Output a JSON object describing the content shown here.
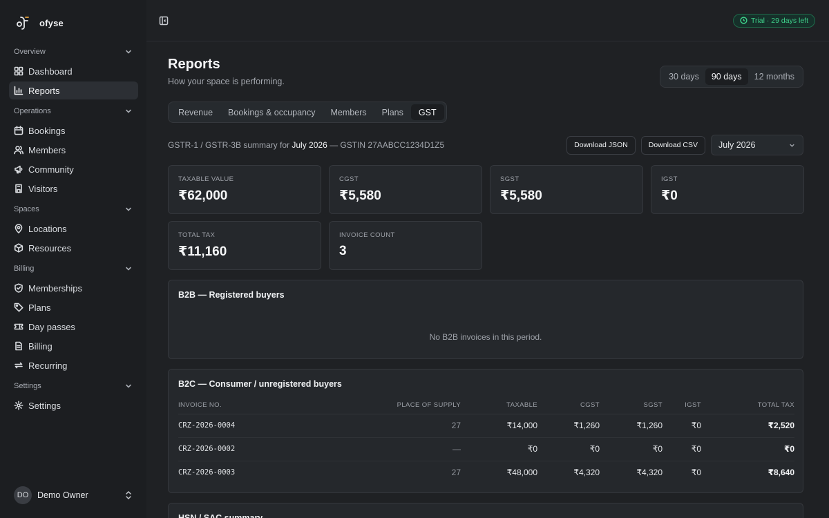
{
  "brand": {
    "name": "ofyse"
  },
  "sidebar": {
    "sections": [
      {
        "label": "Overview",
        "items": [
          {
            "label": "Dashboard",
            "icon": "grid-icon"
          },
          {
            "label": "Reports",
            "icon": "bar-chart-icon",
            "active": true
          }
        ]
      },
      {
        "label": "Operations",
        "items": [
          {
            "label": "Bookings",
            "icon": "calendar-icon"
          },
          {
            "label": "Members",
            "icon": "users-icon"
          },
          {
            "label": "Community",
            "icon": "megaphone-icon"
          },
          {
            "label": "Visitors",
            "icon": "badge-icon"
          }
        ]
      },
      {
        "label": "Spaces",
        "items": [
          {
            "label": "Locations",
            "icon": "map-pin-icon"
          },
          {
            "label": "Resources",
            "icon": "box-icon"
          }
        ]
      },
      {
        "label": "Billing",
        "items": [
          {
            "label": "Memberships",
            "icon": "shield-icon"
          },
          {
            "label": "Plans",
            "icon": "tag-icon"
          },
          {
            "label": "Day passes",
            "icon": "ticket-icon"
          },
          {
            "label": "Billing",
            "icon": "file-icon"
          },
          {
            "label": "Recurring",
            "icon": "repeat-icon"
          }
        ]
      },
      {
        "label": "Settings",
        "items": [
          {
            "label": "Settings",
            "icon": "gear-icon"
          }
        ]
      }
    ],
    "user": {
      "initials": "DO",
      "name": "Demo Owner"
    }
  },
  "topbar": {
    "trial": "Trial · 29 days left"
  },
  "page": {
    "title": "Reports",
    "subtitle": "How your space is performing.",
    "ranges": [
      "30 days",
      "90 days",
      "12 months"
    ],
    "active_range": "90 days",
    "tabs": [
      "Revenue",
      "Bookings & occupancy",
      "Members",
      "Plans",
      "GST"
    ],
    "active_tab": "GST"
  },
  "gst": {
    "summary_prefix": "GSTR-1 / GSTR-3B summary for",
    "period": "July 2026",
    "gstin_text": "— GSTIN 27AABCC1234D1Z5",
    "download_json": "Download JSON",
    "download_csv": "Download CSV",
    "month_select": "July 2026",
    "stats": [
      {
        "label": "Taxable value",
        "value": "₹62,000"
      },
      {
        "label": "CGST",
        "value": "₹5,580"
      },
      {
        "label": "SGST",
        "value": "₹5,580"
      },
      {
        "label": "IGST",
        "value": "₹0"
      },
      {
        "label": "Total tax",
        "value": "₹11,160"
      },
      {
        "label": "Invoice count",
        "value": "3"
      }
    ],
    "b2b": {
      "title": "B2B — Registered buyers",
      "empty": "No B2B invoices in this period."
    },
    "b2c": {
      "title": "B2C — Consumer / unregistered buyers",
      "columns": [
        "Invoice no.",
        "Place of supply",
        "Taxable",
        "CGST",
        "SGST",
        "IGST",
        "Total tax"
      ],
      "rows": [
        [
          "CRZ-2026-0004",
          "27",
          "₹14,000",
          "₹1,260",
          "₹1,260",
          "₹0",
          "₹2,520"
        ],
        [
          "CRZ-2026-0002",
          "—",
          "₹0",
          "₹0",
          "₹0",
          "₹0",
          "₹0"
        ],
        [
          "CRZ-2026-0003",
          "27",
          "₹48,000",
          "₹4,320",
          "₹4,320",
          "₹0",
          "₹8,640"
        ]
      ]
    },
    "hsn": {
      "title": "HSN / SAC summary"
    }
  }
}
